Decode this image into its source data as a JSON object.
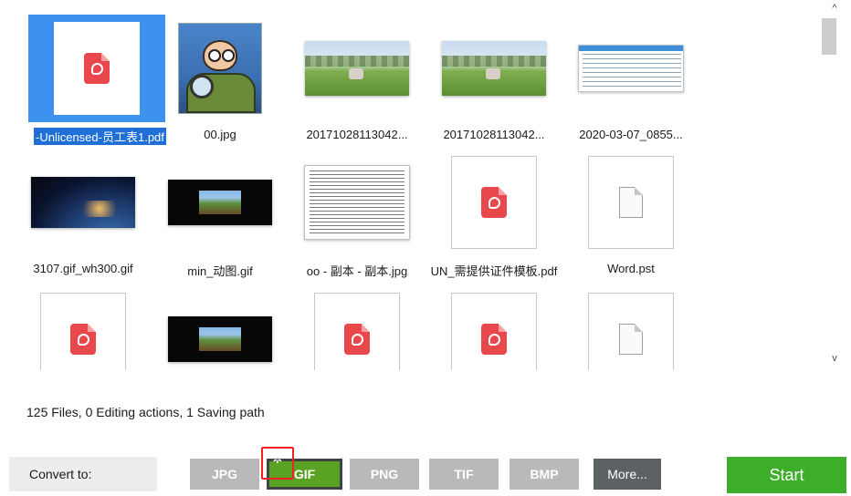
{
  "files": [
    {
      "name": "-Unlicensed-员工表1.pdf",
      "thumb": "pdf",
      "selected": true
    },
    {
      "name": "00.jpg",
      "thumb": "portrait"
    },
    {
      "name": "20171028113042...",
      "thumb": "field"
    },
    {
      "name": "20171028113042...",
      "thumb": "field"
    },
    {
      "name": "2020-03-07_0855...",
      "thumb": "table"
    },
    {
      "name": "3107.gif_wh300.gif",
      "thumb": "earth"
    },
    {
      "name": "min_动图.gif",
      "thumb": "minecraft"
    },
    {
      "name": "oo - 副本 - 副本.jpg",
      "thumb": "text-page"
    },
    {
      "name": "UN_需提供证件模板.pdf",
      "thumb": "pdf"
    },
    {
      "name": "Word.pst",
      "thumb": "blank"
    },
    {
      "name": "",
      "thumb": "pdf"
    },
    {
      "name": "",
      "thumb": "minecraft"
    },
    {
      "name": "",
      "thumb": "pdf"
    },
    {
      "name": "",
      "thumb": "pdf"
    },
    {
      "name": "",
      "thumb": "blank"
    }
  ],
  "scrollbar": {
    "up_icon": "^",
    "down_icon": "v"
  },
  "status": "125 Files, 0 Editing actions, 1 Saving path",
  "toolbar": {
    "convert_label": "Convert to:",
    "formats": [
      "JPG",
      "GIF",
      "PNG",
      "TIF",
      "BMP",
      "More..."
    ],
    "active_format": "GIF",
    "settings_icon": "gear-icon",
    "start_label": "Start"
  },
  "colors": {
    "selection": "#3d92f0",
    "active_format": "#5aa224",
    "start": "#3cae2a",
    "inactive_format": "#b7b9bb",
    "more": "#5c6164",
    "highlight_box": "#ee2222"
  }
}
